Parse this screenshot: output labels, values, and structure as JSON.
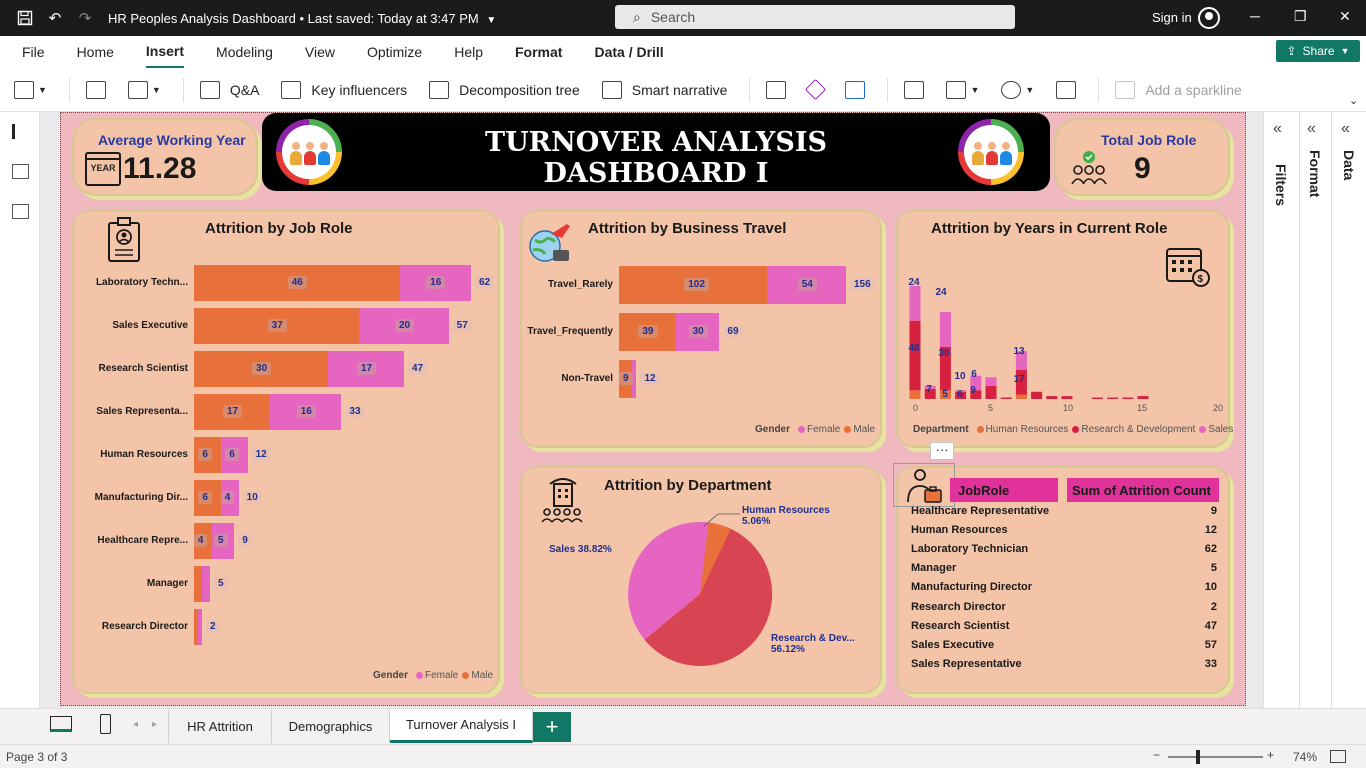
{
  "app": {
    "title": "HR Peoples Analysis Dashboard",
    "saved": "Last saved: Today at 3:47 PM",
    "search_placeholder": "Search",
    "signin": "Sign in",
    "share": "Share"
  },
  "menu": [
    "File",
    "Home",
    "Insert",
    "Modeling",
    "View",
    "Optimize",
    "Help",
    "Format",
    "Data / Drill"
  ],
  "ribbon": {
    "qa": "Q&A",
    "key_influencers": "Key influencers",
    "decomposition_tree": "Decomposition tree",
    "smart_narrative": "Smart narrative",
    "add_sparkline": "Add a sparkline"
  },
  "panes": {
    "filters": "Filters",
    "format": "Format",
    "data": "Data"
  },
  "kpi": {
    "avg_working_year_label": "Average Working Year",
    "avg_working_year_value": "11.28",
    "year_icon_text": "YEAR",
    "total_job_role_label": "Total Job Role",
    "total_job_role_value": "9"
  },
  "banner": {
    "line1": "TURNOVER ANALYSIS",
    "line2": "DASHBOARD I"
  },
  "colors": {
    "male": "#e8703a",
    "female": "#e565c0",
    "hr": "#e8703a",
    "rd": "#d7223f",
    "sales": "#e565c0",
    "table_head": "#e0329a"
  },
  "job_role_chart": {
    "title": "Attrition by Job Role",
    "legend_title": "Gender",
    "legend": [
      "Female",
      "Male"
    ],
    "rows": [
      {
        "label": "Laboratory Techn...",
        "male": "46",
        "female": "16",
        "total": "62"
      },
      {
        "label": "Sales Executive",
        "male": "37",
        "female": "20",
        "total": "57"
      },
      {
        "label": "Research Scientist",
        "male": "30",
        "female": "17",
        "total": "47"
      },
      {
        "label": "Sales Representa...",
        "male": "17",
        "female": "16",
        "total": "33"
      },
      {
        "label": "Human Resources",
        "male": "6",
        "female": "6",
        "total": "12"
      },
      {
        "label": "Manufacturing Dir...",
        "male": "6",
        "female": "4",
        "total": "10"
      },
      {
        "label": "Healthcare Repre...",
        "male": "4",
        "female": "5",
        "total": "9"
      },
      {
        "label": "Manager",
        "male": "",
        "female": "",
        "total": "5"
      },
      {
        "label": "Research Director",
        "male": "",
        "female": "",
        "total": "2"
      }
    ]
  },
  "business_travel_chart": {
    "title": "Attrition by Business Travel",
    "legend_title": "Gender",
    "legend": [
      "Female",
      "Male"
    ],
    "rows": [
      {
        "label": "Travel_Rarely",
        "male": "102",
        "female": "54",
        "total": "156"
      },
      {
        "label": "Travel_Frequently",
        "male": "39",
        "female": "30",
        "total": "69"
      },
      {
        "label": "Non-Travel",
        "male": "9",
        "female": "",
        "total": "12"
      }
    ]
  },
  "years_role_chart": {
    "title": "Attrition by Years in Current Role",
    "x_ticks": [
      "0",
      "5",
      "10",
      "15",
      "20"
    ],
    "legend_title": "Department",
    "legend": [
      "Human Resources",
      "Research & Development",
      "Sales"
    ],
    "labels": [
      {
        "text": "24"
      },
      {
        "text": "24"
      },
      {
        "text": "48"
      },
      {
        "text": "30"
      },
      {
        "text": "7"
      },
      {
        "text": "5"
      },
      {
        "text": "6"
      },
      {
        "text": "9"
      },
      {
        "text": "10"
      },
      {
        "text": "6"
      },
      {
        "text": "13"
      },
      {
        "text": "17"
      }
    ]
  },
  "department_chart": {
    "title": "Attrition by Department",
    "slices": [
      {
        "name": "Human Resources",
        "pct": "5.06%"
      },
      {
        "name": "Sales 38.82%",
        "pct": ""
      },
      {
        "name": "Research & Dev...",
        "pct": "56.12%"
      }
    ]
  },
  "table": {
    "headers": [
      "JobRole",
      "Sum of Attrition Count"
    ],
    "rows": [
      {
        "role": "Healthcare Representative",
        "count": "9"
      },
      {
        "role": "Human Resources",
        "count": "12"
      },
      {
        "role": "Laboratory Technician",
        "count": "62"
      },
      {
        "role": "Manager",
        "count": "5"
      },
      {
        "role": "Manufacturing Director",
        "count": "10"
      },
      {
        "role": "Research Director",
        "count": "2"
      },
      {
        "role": "Research Scientist",
        "count": "47"
      },
      {
        "role": "Sales Executive",
        "count": "57"
      },
      {
        "role": "Sales Representative",
        "count": "33"
      }
    ],
    "more_icon": "···"
  },
  "tabs": [
    "HR Attrition",
    "Demographics",
    "Turnover Analysis I"
  ],
  "status": {
    "page": "Page 3 of 3",
    "zoom": "74%"
  }
}
